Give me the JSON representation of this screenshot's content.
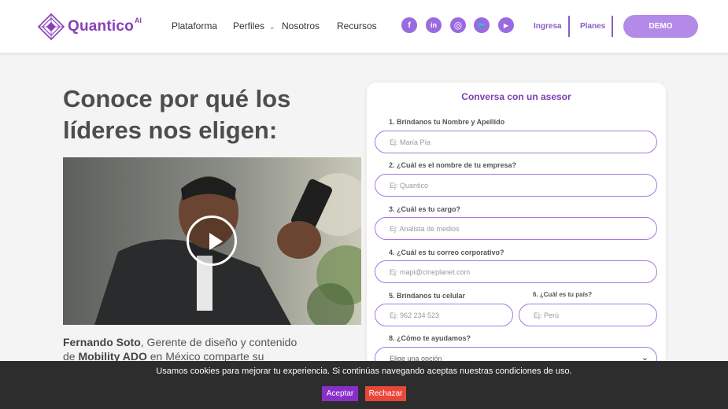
{
  "brand": {
    "name": "Quantico",
    "suffix": "AI",
    "color": "#8a3fb8"
  },
  "nav": [
    {
      "label": "Plataforma"
    },
    {
      "label": "Perfiles",
      "has_dropdown": true
    },
    {
      "label": "Nosotros"
    },
    {
      "label": "Recursos"
    }
  ],
  "social": [
    {
      "icon": "facebook-icon",
      "glyph": "f"
    },
    {
      "icon": "linkedin-icon",
      "glyph": "in"
    },
    {
      "icon": "instagram-icon",
      "glyph": "◎"
    },
    {
      "icon": "twitter-icon",
      "glyph": "🐦"
    },
    {
      "icon": "youtube-icon",
      "glyph": "▶"
    }
  ],
  "header_links": {
    "login": "Ingresa",
    "plans": "Planes",
    "demo": "DEMO"
  },
  "hero": {
    "title": "Conoce por qué los líderes nos eligen:"
  },
  "testimonial": {
    "name": "Fernando Soto",
    "role_text": ", Gerente de diseño y contenido de",
    "company": "Mobility ADO",
    "rest_text": " en México comparte su experiencia"
  },
  "form": {
    "title": "Conversa con un asesor",
    "fields": [
      {
        "label": "1. Bríndanos tu Nombre y Apellido",
        "placeholder": "Ej: María Pía"
      },
      {
        "label": "2. ¿Cuál es el nombre de tu empresa?",
        "placeholder": "Ej: Quantico"
      },
      {
        "label": "3. ¿Cuál es tu cargo?",
        "placeholder": "Ej: Analista de medios"
      },
      {
        "label": "4. ¿Cuál es tu correo corporativo?",
        "placeholder": "Ej: mapi@cineplanet.com"
      },
      {
        "label": "5. Bríndanos tu celular",
        "placeholder": "Ej: 962 234 523"
      },
      {
        "label": "6. ¿Cuál es tu país?",
        "placeholder": "Ej: Perú"
      }
    ],
    "help": {
      "label": "8. ¿Cómo te ayudamos?",
      "selected": "Elige una opción"
    }
  },
  "cookie": {
    "text": "Usamos cookies para mejorar tu experiencia. Si continúas navegando aceptas nuestras condiciones de uso.",
    "accept": "Aceptar",
    "reject": "Rechazar"
  },
  "colors": {
    "accent": "#8a5cc9",
    "demo_bg": "#b48ae8",
    "accept_bg": "#8a2ec9",
    "reject_bg": "#e9473b"
  }
}
